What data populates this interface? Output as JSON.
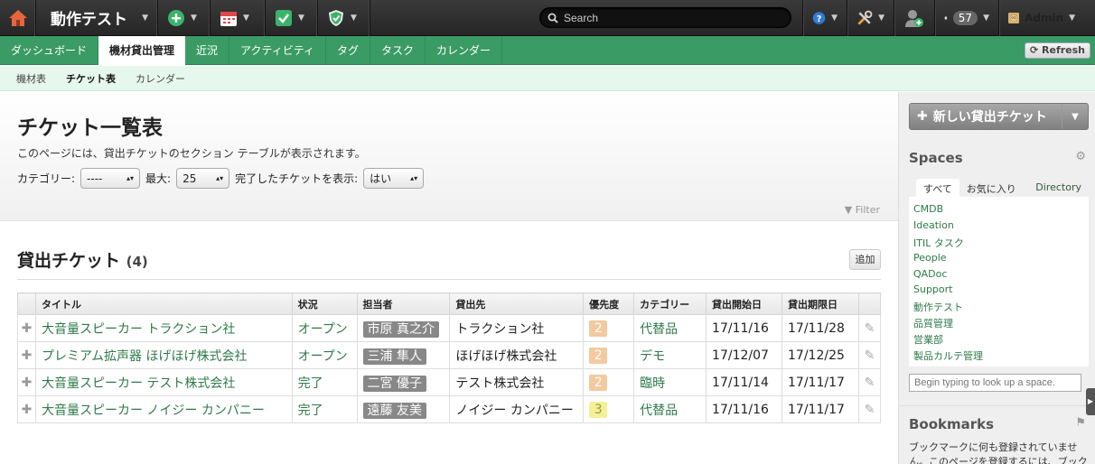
{
  "topbar": {
    "workspace_name": "動作テスト",
    "search_placeholder": "Search",
    "notification_count": "57",
    "user_name": "Admin"
  },
  "nav": {
    "tabs": [
      {
        "label": "ダッシュボード"
      },
      {
        "label": "機材貸出管理"
      },
      {
        "label": "近況"
      },
      {
        "label": "アクティビティ"
      },
      {
        "label": "タグ"
      },
      {
        "label": "タスク"
      },
      {
        "label": "カレンダー"
      }
    ],
    "refresh_label": "Refresh"
  },
  "subnav": {
    "items": [
      {
        "label": "機材表"
      },
      {
        "label": "チケット表"
      },
      {
        "label": "カレンダー"
      }
    ]
  },
  "page": {
    "title": "チケット一覧表",
    "description": "このページには、貸出チケットのセクション テーブルが表示されます。",
    "filters": {
      "category_label": "カテゴリー:",
      "category_value": "----",
      "max_label": "最大:",
      "max_value": "25",
      "show_done_label": "完了したチケットを表示:",
      "show_done_value": "はい"
    },
    "filter_link": "Filter"
  },
  "section": {
    "title": "貸出チケット",
    "count": "(4)",
    "add_label": "追加",
    "columns": [
      "タイトル",
      "状況",
      "担当者",
      "貸出先",
      "優先度",
      "カテゴリー",
      "貸出開始日",
      "貸出期限日"
    ],
    "rows": [
      {
        "title": "大音量スピーカー トラクション社",
        "status": "オープン",
        "assignee": "市原 真之介",
        "lendee": "トラクション社",
        "priority": "2",
        "category": "代替品",
        "start": "17/11/16",
        "due": "17/11/28"
      },
      {
        "title": "プレミアム拡声器 ほげほげ株式会社",
        "status": "オープン",
        "assignee": "三浦 隼人",
        "lendee": "ほげほげ株式会社",
        "priority": "2",
        "category": "デモ",
        "start": "17/12/07",
        "due": "17/12/25"
      },
      {
        "title": "大音量スピーカー テスト株式会社",
        "status": "完了",
        "assignee": "二宮 優子",
        "lendee": "テスト株式会社",
        "priority": "2",
        "category": "臨時",
        "start": "17/11/14",
        "due": "17/11/17"
      },
      {
        "title": "大音量スピーカー ノイジー カンパニー",
        "status": "完了",
        "assignee": "遠藤 友美",
        "lendee": "ノイジー カンパニー",
        "priority": "3",
        "category": "代替品",
        "start": "17/11/16",
        "due": "17/11/17"
      }
    ]
  },
  "sidebar": {
    "new_ticket_label": "新しい貸出チケット",
    "spaces_title": "Spaces",
    "space_tabs": [
      "すべて",
      "お気に入り",
      "Directory"
    ],
    "spaces": [
      "CMDB",
      "Ideation",
      "ITIL タスク",
      "People",
      "QADoc",
      "Support",
      "動作テスト",
      "品質管理",
      "営業部",
      "製品カルテ管理"
    ],
    "space_search_placeholder": "Begin typing to look up a space.",
    "bookmarks_title": "Bookmarks",
    "bookmarks_text": "ブックマークに何も登録されていません。このページを登録するには、ブック"
  },
  "colors": {
    "brand_green": "#3b9b64",
    "link_green": "#2f7a4a",
    "subnav_bg": "#e6f7ee",
    "priority2": "#f3c9a0",
    "priority3": "#f5f098"
  }
}
